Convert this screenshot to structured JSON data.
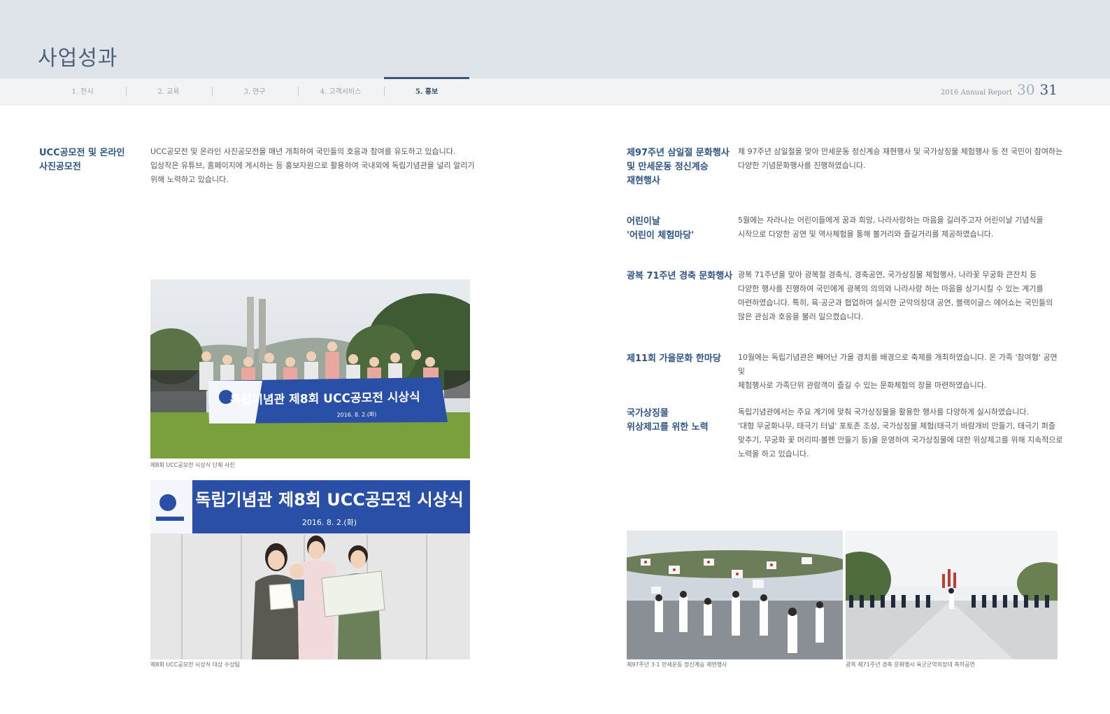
{
  "header": {
    "page_title": "사업성과",
    "report_label": "2016 Annual Report",
    "page_left": "30",
    "page_right": "31"
  },
  "nav": {
    "tabs": [
      {
        "label": "1. 전시"
      },
      {
        "label": "2. 교육"
      },
      {
        "label": "3. 연구"
      },
      {
        "label": "4. 고객서비스"
      },
      {
        "label": "5. 홍보"
      }
    ],
    "active_index": 4
  },
  "left": {
    "title_line1": "UCC공모전 및 온라인",
    "title_line2": "사진공모전",
    "body_lines": [
      "UCC공모전 및 온라인 사진공모전을 매년 개최하여 국민들의 호응과 참여를 유도하고 있습니다.",
      "입상작은 유튜브, 홈페이지에 게시하는 등 홍보자원으로 활용하여 국내외에 독립기념관을 널리 알리기",
      "위해 노력하고 있습니다."
    ],
    "photo1": {
      "banner_title": "독립기념관 제8회 UCC공모전 시상식",
      "banner_date": "2016. 8. 2.(화)",
      "caption": "제8회 UCC공모전 시상식 단체 사진"
    },
    "photo2": {
      "banner_title": "독립기념관 제8회 UCC공모전 시상식",
      "banner_date": "2016. 8. 2.(화)",
      "caption": "제8회 UCC공모전 시상식 대상 수상팀"
    }
  },
  "right": {
    "sections": [
      {
        "title": [
          "제97주년 삼일절 문화행사",
          "및 만세운동 정신계승",
          "재현행사"
        ],
        "body": [
          "제 97주년 삼일절을 맞아 만세운동 정신계승 재현행사 및 국가상징물 체험행사 등 전 국민이 참여하는",
          "다양한 기념문화행사를 진행하였습니다."
        ]
      },
      {
        "title": [
          "어린이날",
          "'어린이 체험마당'"
        ],
        "body": [
          "5월에는 자라나는 어린이들에게 꿈과 희망, 나라사랑하는 마음을 길러주고자 어린이날 기념식을",
          "시작으로 다양한 공연 및 역사체험을 통해 볼거리와 즐길거리를 제공하였습니다."
        ]
      },
      {
        "title": [
          "광복 71주년 경축 문화행사"
        ],
        "body": [
          "광복 71주년을 맞아 광복절 경축식, 경축공연, 국가상징물 체험행사, 나라꽃 무궁화 큰잔치 등",
          "다양한 행사를 진행하여 국민에게 광복의 의의와 나라사랑 하는 마음을 상기시킬 수 있는 계기를",
          "마련하였습니다. 특히, 육·공군과 협업하여 실시한 군악의장대 공연, 블랙이글스 에어쇼는 국민들의",
          "많은 관심과 호응을 불러 일으켰습니다."
        ]
      },
      {
        "title": [
          "제11회 가을문화 한마당"
        ],
        "body": [
          "10월에는 독립기념관은 빼어난 가을 경치를 배경으로 축제를 개최하였습니다. 온 가족 '참여형' 공연 및",
          "체험행사로 가족단위 관람객이 즐길 수 있는 문화체험의 장을 마련하였습니다."
        ]
      },
      {
        "title": [
          "국가상징물",
          "위상제고를 위한 노력"
        ],
        "body": [
          "독립기념관에서는 주요 계기에 맞춰 국가상징물을 활용한 행사를 다양하게 실시하였습니다.",
          "'대형 무궁화나무, 태극기 터널' 포토존 조성, 국가상징물 체험(태극기 바람개비 만들기, 태극기 퍼즐",
          "맞추기, 무궁화 꽃 머리띠·볼펜 만들기 등)을 운영하여 국가상징물에 대한 위상제고를 위해 지속적으로",
          "노력을 하고 있습니다."
        ]
      }
    ],
    "photo3_caption": "제97주년 3·1 만세운동 정신계승 재현행사",
    "photo4_caption": "광복 제71주년 경축 문화행사 육군군악의장대 축하공연"
  },
  "colors": {
    "accent": "#2e5585",
    "banner_blue": "#2a4fa6",
    "header_band": "#dfe4ea"
  }
}
